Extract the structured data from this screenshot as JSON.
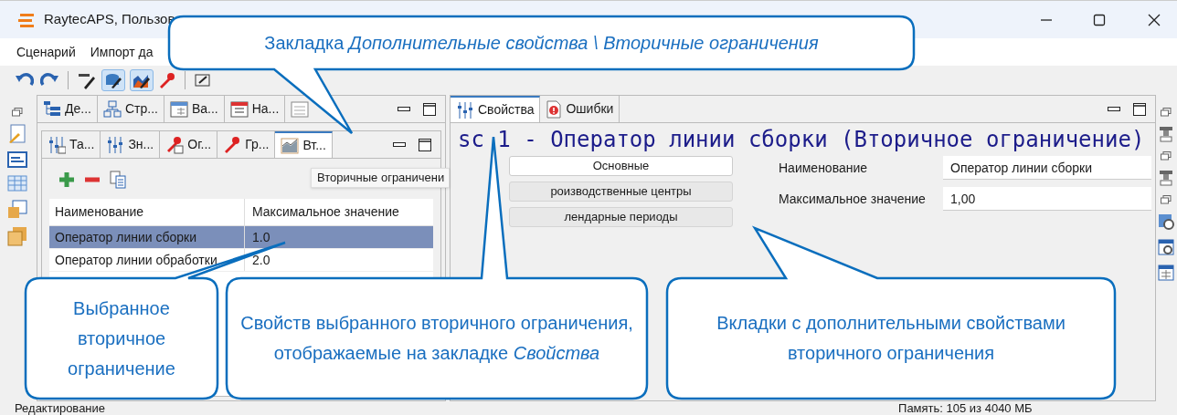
{
  "window": {
    "title": "RaytecAPS, Пользов"
  },
  "menu": [
    "Сценарий",
    "Импорт да"
  ],
  "outer_tabs": [
    {
      "label": "Де..."
    },
    {
      "label": "Стр..."
    },
    {
      "label": "Ва..."
    },
    {
      "label": "На..."
    }
  ],
  "inner_tabs": [
    {
      "label": "Та...",
      "selected": false
    },
    {
      "label": "Зн...",
      "selected": false
    },
    {
      "label": "Ог...",
      "selected": false
    },
    {
      "label": "Гр...",
      "selected": false
    },
    {
      "label": "Вт...",
      "selected": true
    }
  ],
  "tooltip": "Вторичные ограничени",
  "table": {
    "columns": [
      "Наименование",
      "Максимальное значение"
    ],
    "rows": [
      {
        "name": "Оператор линии сборки",
        "max": "1.0",
        "selected": true
      },
      {
        "name": "Оператор линии обработки",
        "max": "2.0",
        "selected": false
      }
    ]
  },
  "right_tabs": [
    {
      "label": "Свойства",
      "selected": true
    },
    {
      "label": "Ошибки",
      "selected": false
    }
  ],
  "heading": {
    "prefix": "sc",
    "rest": "1 - Оператор линии сборки (Вторичное ограничение)"
  },
  "sections": [
    {
      "label": "Основные",
      "selected": true
    },
    {
      "label": "роизводственные центры",
      "selected": false
    },
    {
      "label": "лендарные периоды",
      "selected": false
    }
  ],
  "fields": [
    {
      "label": "Наименование",
      "value": "Оператор линии сборки"
    },
    {
      "label": "Максимальное значение",
      "value": "1,00"
    }
  ],
  "status_bar": {
    "left": "Редактирование",
    "right": "Память: 105 из 4040 МБ"
  },
  "callouts": [
    "Закладка *Дополнительные свойства \\ Вторичные ограничения*",
    "Выбранное вторичное ограничение",
    "Свойств выбранного вторичного ограничения, отображаемые на закладке *Свойства*",
    "Вкладки с дополнительными свойствами вторичного ограничения"
  ]
}
